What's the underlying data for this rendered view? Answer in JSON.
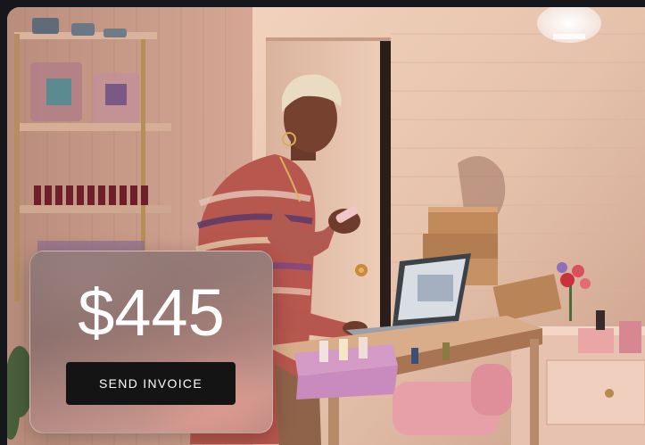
{
  "invoice": {
    "amount": "$445",
    "send_label": "SEND INVOICE"
  },
  "colors": {
    "page_background": "#16171a",
    "button_background": "#141414",
    "button_text": "#ffffff",
    "amount_text": "#ffffff"
  }
}
